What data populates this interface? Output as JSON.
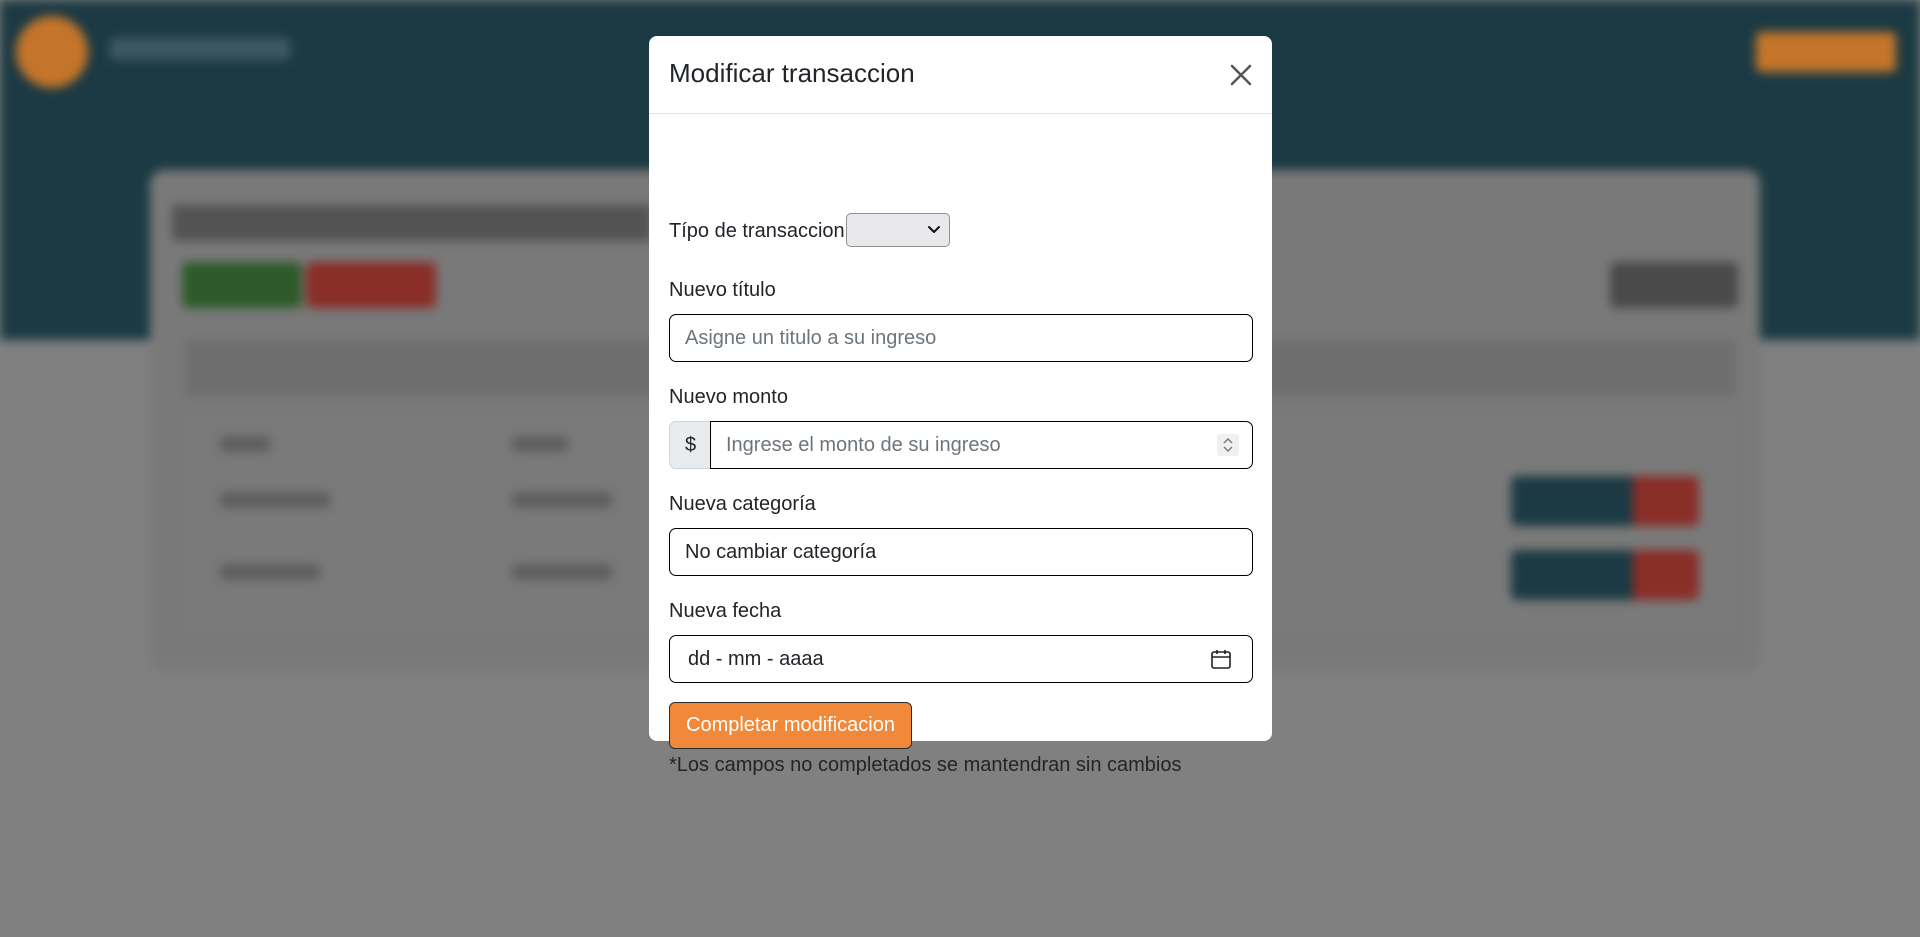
{
  "modal": {
    "title": "Modificar transaccion",
    "type_label": "Típo de transaccion",
    "type_value": "",
    "title_label": "Nuevo título",
    "title_placeholder": "Asigne un titulo a su ingreso",
    "amount_label": "Nuevo monto",
    "amount_prefix": "$",
    "amount_placeholder": "Ingrese el monto de su ingreso",
    "category_label": "Nueva categoría",
    "category_value": "No cambiar categoría",
    "date_label": "Nueva fecha",
    "date_placeholder": "dd - mm - aaaa",
    "submit_label": "Completar modificacion",
    "note": "*Los campos no completados se mantendran sin cambios"
  },
  "colors": {
    "header_bg": "#1c3a43",
    "accent_orange": "#f0893a",
    "overlay": "#808080"
  },
  "icons": {
    "close": "close-icon",
    "select": "chevron-down-icon",
    "date": "calendar-icon",
    "spinner": "spinner-icon"
  }
}
